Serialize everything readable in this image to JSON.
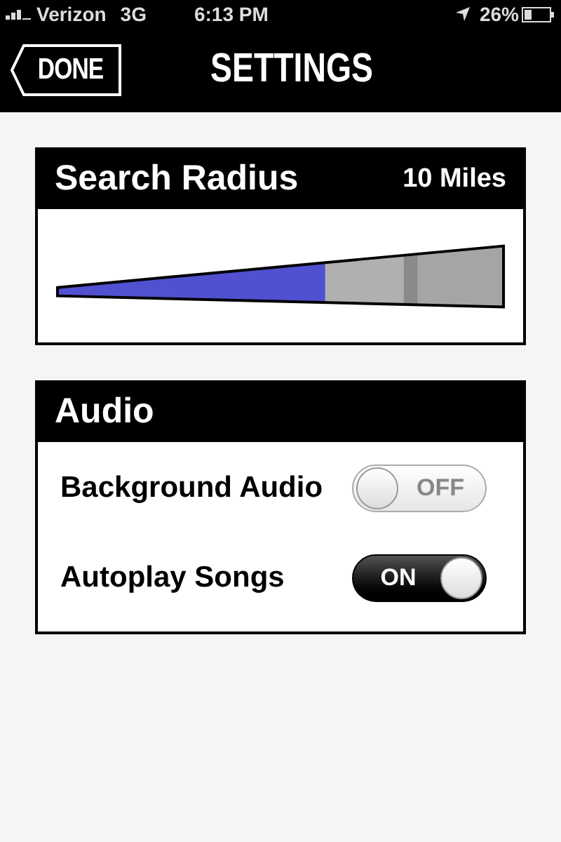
{
  "status_bar": {
    "carrier": "Verizon",
    "network": "3G",
    "time": "6:13 PM",
    "battery": "26%"
  },
  "nav": {
    "back": "DONE",
    "title": "SETTINGS"
  },
  "search_radius": {
    "title": "Search Radius",
    "value": "10 Miles",
    "level": 0.6
  },
  "audio": {
    "title": "Audio",
    "settings": [
      {
        "label": "Background Audio",
        "on": false,
        "switch_text": "OFF"
      },
      {
        "label": "Autoplay Songs",
        "on": true,
        "switch_text": "ON"
      }
    ]
  }
}
